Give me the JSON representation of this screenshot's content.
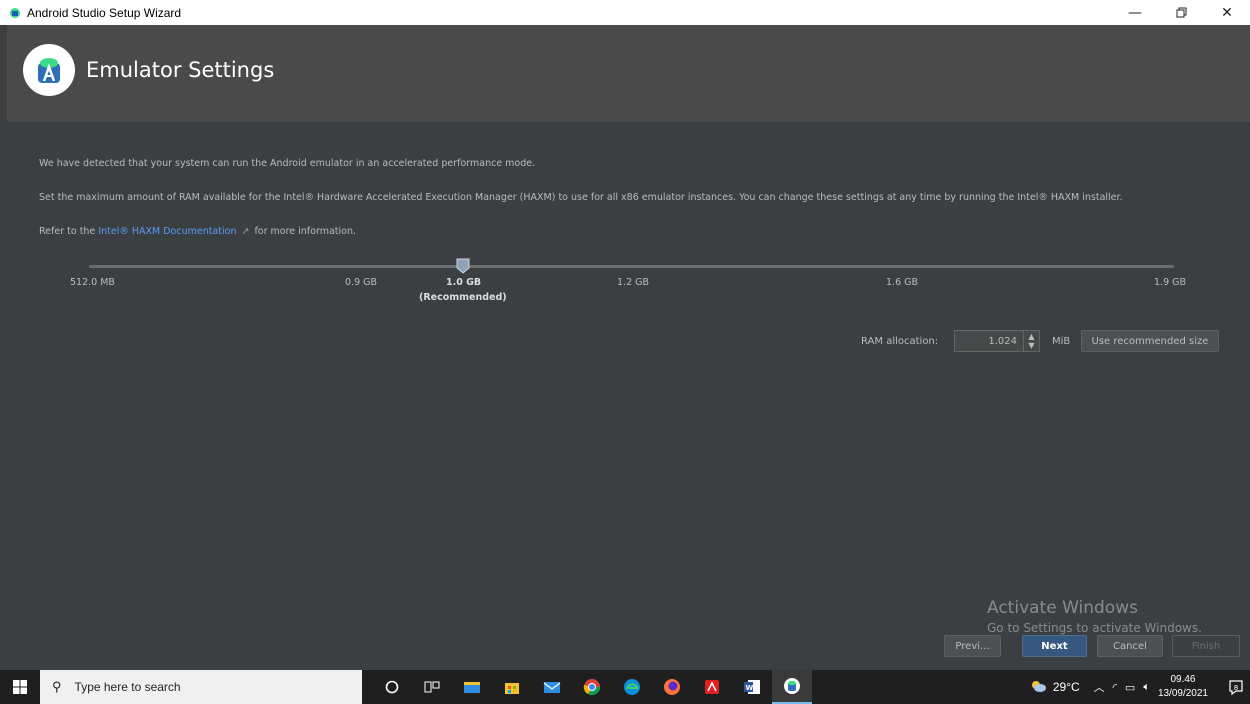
{
  "window": {
    "title": "Android Studio Setup Wizard",
    "controls": [
      "minimize",
      "maximize",
      "close"
    ]
  },
  "header": {
    "title": "Emulator Settings"
  },
  "content": {
    "line1": "We have detected that your system can run the Android emulator in an accelerated performance mode.",
    "line2": "Set the maximum amount of RAM available for the Intel® Hardware Accelerated Execution Manager (HAXM) to use for all x86 emulator instances. You can change these settings at any time by running the Intel® HAXM installer.",
    "line3_prefix": "Refer to the",
    "line3_link": "Intel® HAXM Documentation",
    "line3_arrow": "↗",
    "line3_suffix": "for more information."
  },
  "slider": {
    "ticks": [
      "512.0 MB",
      "0.9 GB",
      "1.0 GB",
      "1.2 GB",
      "1.6 GB",
      "1.9 GB"
    ],
    "selected": "1.0 GB",
    "recommended_label": "(Recommended)"
  },
  "ram": {
    "label": "RAM allocation:",
    "value": "1.024",
    "unit": "MiB",
    "use_recommended": "Use recommended size"
  },
  "buttons": {
    "previous": "Previ...",
    "next": "Next",
    "cancel": "Cancel",
    "finish": "Finish"
  },
  "watermark": {
    "line1": "Activate Windows",
    "line2": "Go to Settings to activate Windows."
  },
  "taskbar": {
    "search_placeholder": "Type here to search",
    "temperature": "29°C",
    "time": "09.46",
    "date": "13/09/2021",
    "notification_count": "8"
  },
  "colors": {
    "accent": "#365880",
    "link": "#589df6",
    "background": "#3c3f41",
    "header": "#4a4a4a"
  }
}
